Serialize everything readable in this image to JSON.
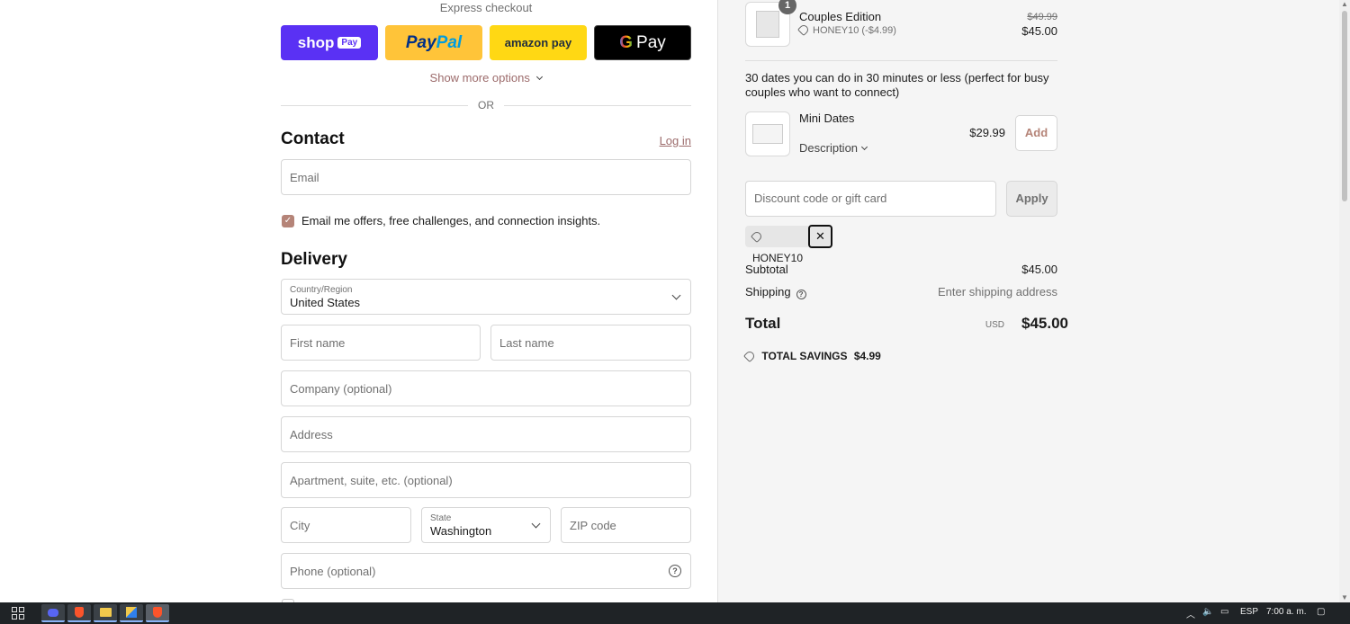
{
  "express": {
    "title": "Express checkout",
    "shop_label": "shop",
    "shop_tag": "Pay",
    "paypal_a": "Pay",
    "paypal_b": "Pal",
    "amazon_label": "amazon pay",
    "gpay_g": "G",
    "gpay_label": "Pay",
    "more_options": "Show more options",
    "or": "OR"
  },
  "contact": {
    "heading": "Contact",
    "login": "Log in",
    "email_placeholder": "Email",
    "offers_label": "Email me offers, free challenges, and connection insights."
  },
  "delivery": {
    "heading": "Delivery",
    "country_label": "Country/Region",
    "country_value": "United States",
    "first_name": "First name",
    "last_name": "Last name",
    "company": "Company (optional)",
    "address": "Address",
    "apartment": "Apartment, suite, etc. (optional)",
    "city": "City",
    "state_label": "State",
    "state_value": "Washington",
    "zip": "ZIP code",
    "phone": "Phone (optional)"
  },
  "summary": {
    "item": {
      "quantity": "1",
      "name": "Couples Edition",
      "discount": "HONEY10 (-$4.99)",
      "original_price": "$49.99",
      "price": "$45.00"
    },
    "upsell_text": "30 dates you can do in 30 minutes or less (perfect for busy couples who want to connect)",
    "upsell": {
      "name": "Mini Dates",
      "description": "Description",
      "price": "$29.99",
      "add": "Add"
    },
    "discount_placeholder": "Discount code or gift card",
    "apply": "Apply",
    "applied_code": "HONEY10",
    "remove_symbol": "✕",
    "subtotal_label": "Subtotal",
    "subtotal_value": "$45.00",
    "shipping_label": "Shipping",
    "shipping_value": "Enter shipping address",
    "total_label": "Total",
    "currency": "USD",
    "total_value": "$45.00",
    "savings_label": "TOTAL SAVINGS",
    "savings_value": "$4.99"
  },
  "taskbar": {
    "language": "ESP",
    "time": "7:00 a. m."
  },
  "colors": {
    "accent": "#b58478",
    "shop_pay": "#5a31f4",
    "paypal": "#ffc439",
    "amazon": "#ffd814",
    "gpay": "#000000"
  }
}
